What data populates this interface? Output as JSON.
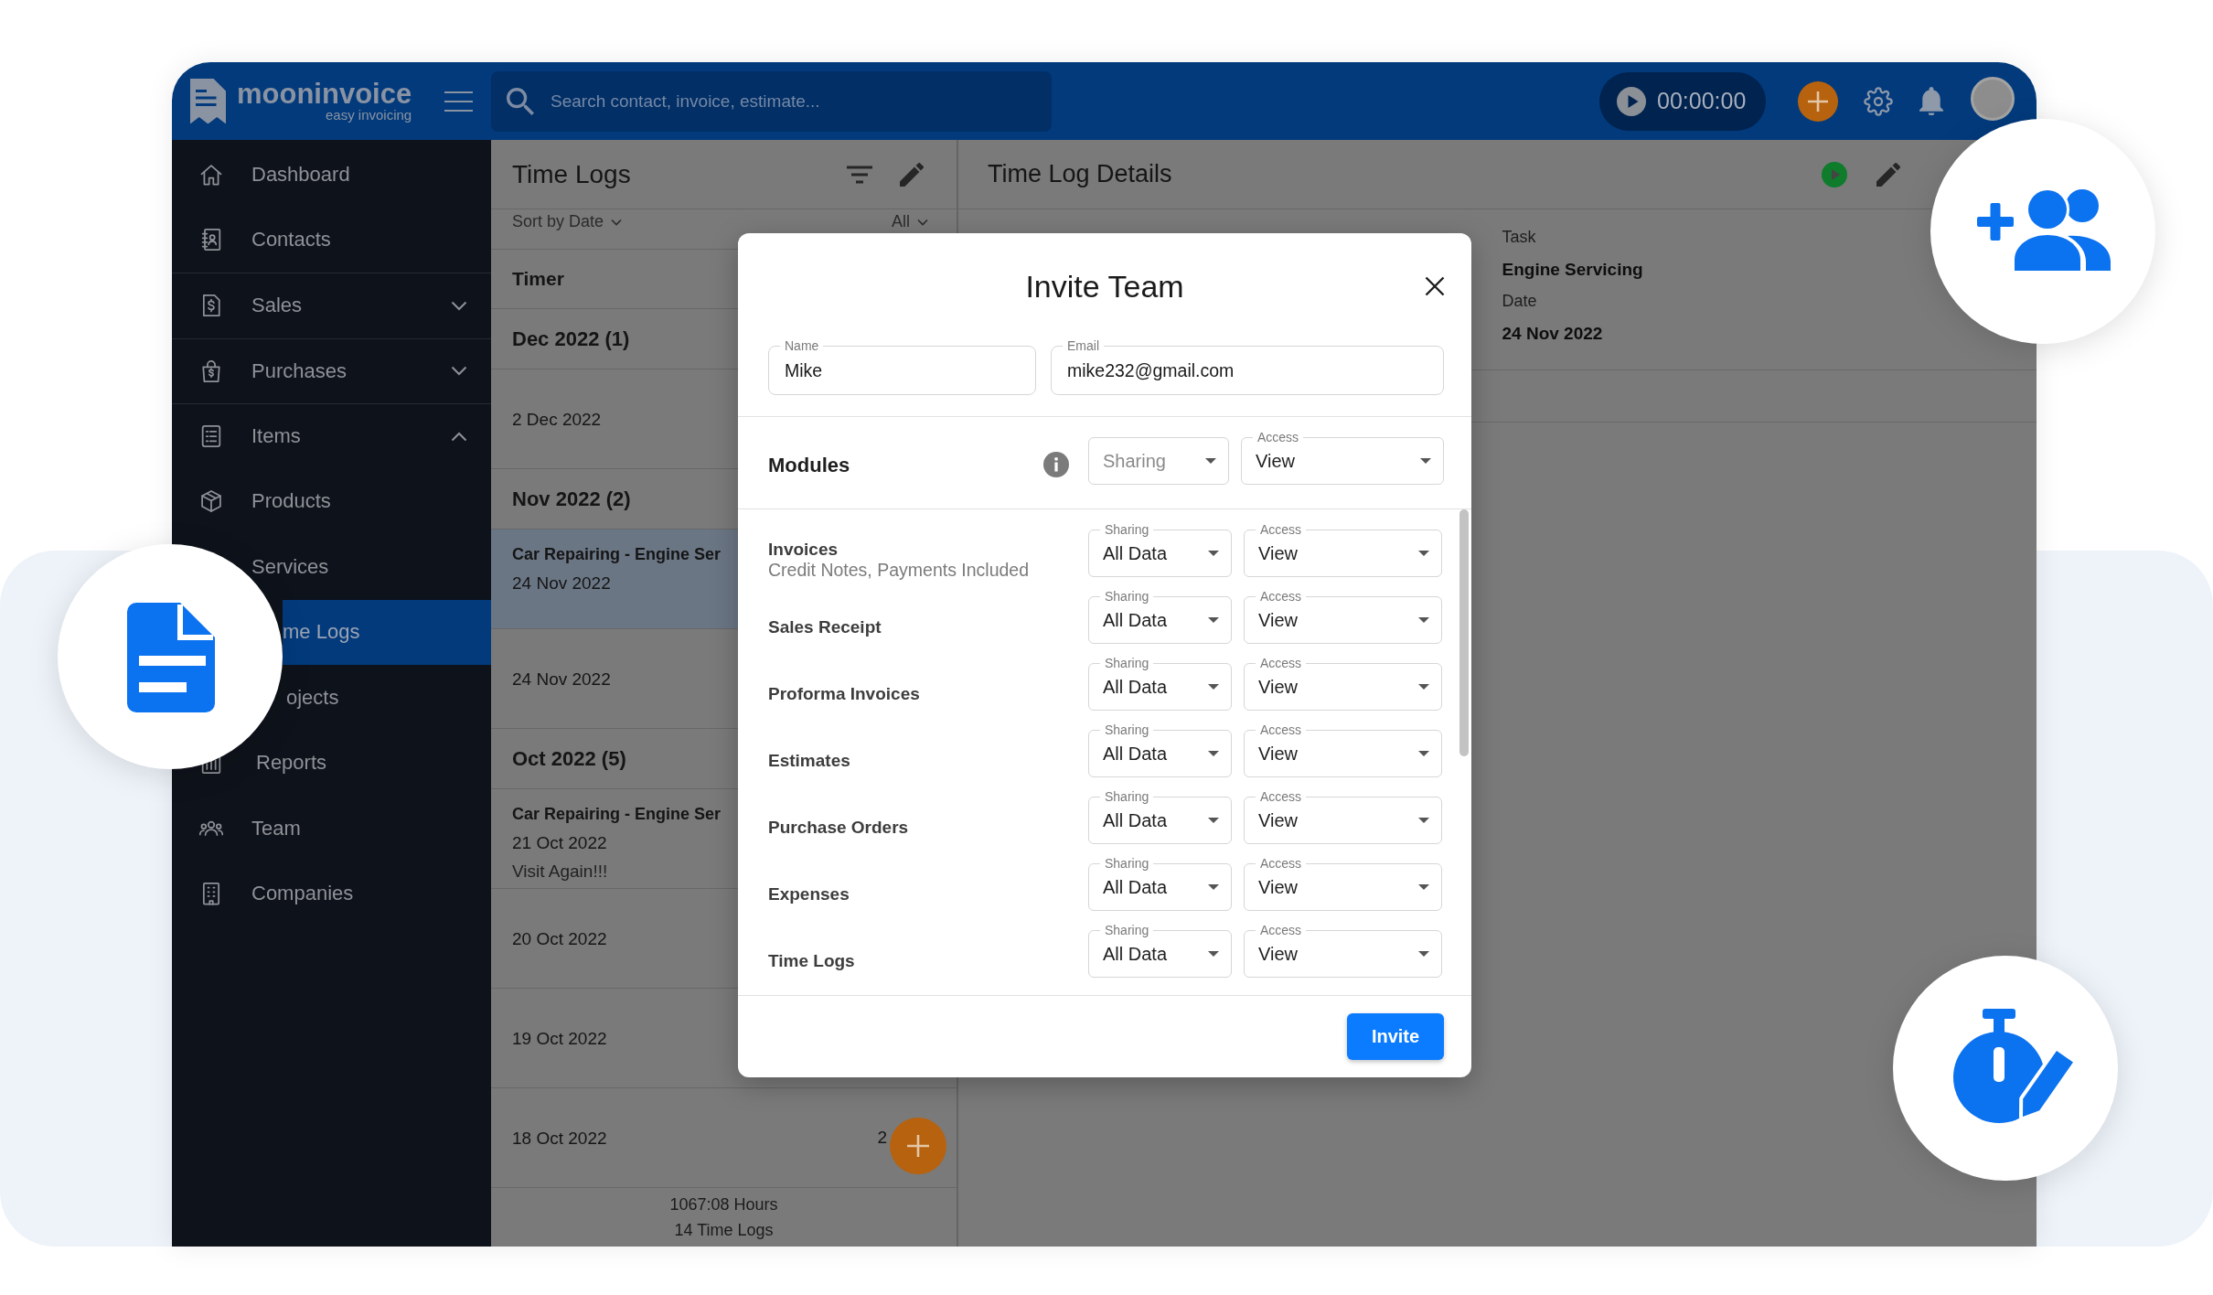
{
  "top_bar": {
    "logo": {
      "name": "mooninvoice",
      "tagline": "easy invoicing"
    },
    "search": {
      "placeholder": "Search contact, invoice, estimate..."
    },
    "timer": "00:00:00"
  },
  "sidebar": {
    "items": [
      {
        "label": "Dashboard",
        "selected": false
      },
      {
        "label": "Contacts",
        "selected": false
      },
      {
        "label": "Sales",
        "selected": false,
        "expanded": false
      },
      {
        "label": "Purchases",
        "selected": false,
        "expanded": false
      },
      {
        "label": "Items",
        "selected": false,
        "expanded": true,
        "children": [
          {
            "label": "Products",
            "selected": false
          },
          {
            "label": "Services",
            "selected": false
          },
          {
            "label": "me Logs",
            "selected": true
          },
          {
            "label": "ojects",
            "selected": false
          }
        ]
      },
      {
        "label": "Reports",
        "selected": false
      },
      {
        "label": "Team",
        "selected": false
      },
      {
        "label": "Companies",
        "selected": false
      }
    ]
  },
  "time_logs": {
    "title": "Time Logs",
    "sort": "Sort by Date",
    "filter": "All",
    "timer_label": "Timer",
    "groups": [
      {
        "heading": "Dec 2022 (1)",
        "entries": [
          {
            "date": "2 Dec 2022",
            "selected": false
          }
        ]
      },
      {
        "heading": "Nov 2022 (2)",
        "entries": [
          {
            "title": "Car Repairing - Engine Ser",
            "date": "24 Nov 2022",
            "selected": true
          },
          {
            "date": "24 Nov 2022",
            "selected": false
          }
        ]
      },
      {
        "heading": "Oct 2022 (5)",
        "entries": [
          {
            "title": "Car Repairing - Engine Ser",
            "date": "21 Oct 2022",
            "note": "Visit Again!!!",
            "selected": false
          },
          {
            "date": "20 Oct 2022",
            "selected": false
          },
          {
            "date": "19 Oct 2022",
            "selected": false
          },
          {
            "date": "18 Oct 2022",
            "value": "2",
            "selected": false
          }
        ]
      }
    ],
    "footer": {
      "hours": "1067:08 Hours",
      "count": "14 Time Logs"
    }
  },
  "details": {
    "title": "Time Log Details",
    "fields": [
      {
        "label": "Task",
        "value": "Engine Servicing"
      },
      {
        "label": "Date",
        "value": "24 Nov 2022"
      }
    ]
  },
  "invite_dialog": {
    "title": "Invite Team",
    "fields": [
      {
        "label": "Name",
        "value": "Mike"
      },
      {
        "label": "Email",
        "value": "mike232@gmail.com"
      }
    ],
    "modules_header": {
      "label": "Modules",
      "sharing": {
        "placeholder": "Sharing"
      },
      "access": {
        "label": "Access",
        "value": "View"
      }
    },
    "modules": [
      {
        "name": "Invoices",
        "note": "Credit Notes, Payments Included",
        "sharing": {
          "label": "Sharing",
          "value": "All Data"
        },
        "access": {
          "label": "Access",
          "value": "View"
        }
      },
      {
        "name": "Sales Receipt",
        "sharing": {
          "label": "Sharing",
          "value": "All Data"
        },
        "access": {
          "label": "Access",
          "value": "View"
        }
      },
      {
        "name": "Proforma Invoices",
        "sharing": {
          "label": "Sharing",
          "value": "All Data"
        },
        "access": {
          "label": "Access",
          "value": "View"
        }
      },
      {
        "name": "Estimates",
        "sharing": {
          "label": "Sharing",
          "value": "All Data"
        },
        "access": {
          "label": "Access",
          "value": "View"
        }
      },
      {
        "name": "Purchase Orders",
        "sharing": {
          "label": "Sharing",
          "value": "All Data"
        },
        "access": {
          "label": "Access",
          "value": "View"
        }
      },
      {
        "name": "Expenses",
        "sharing": {
          "label": "Sharing",
          "value": "All Data"
        },
        "access": {
          "label": "Access",
          "value": "View"
        }
      },
      {
        "name": "Time Logs",
        "sharing": {
          "label": "Sharing",
          "value": "All Data"
        },
        "access": {
          "label": "Access",
          "value": "View"
        }
      }
    ],
    "button": "Invite"
  }
}
